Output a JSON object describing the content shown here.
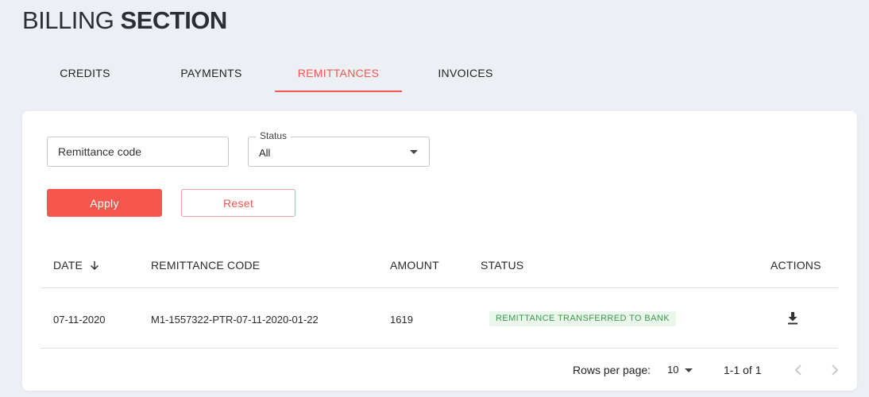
{
  "title": {
    "light": "BILLING",
    "bold": "SECTION"
  },
  "tabs": [
    {
      "label": "CREDITS",
      "active": false
    },
    {
      "label": "PAYMENTS",
      "active": false
    },
    {
      "label": "REMITTANCES",
      "active": true
    },
    {
      "label": "INVOICES",
      "active": false
    }
  ],
  "filters": {
    "remittance_code_placeholder": "Remittance code",
    "status_label": "Status",
    "status_value": "All",
    "apply_label": "Apply",
    "reset_label": "Reset"
  },
  "table": {
    "columns": [
      "DATE",
      "REMITTANCE CODE",
      "AMOUNT",
      "STATUS",
      "ACTIONS"
    ],
    "rows": [
      {
        "date": "07-11-2020",
        "code": "M1-1557322-PTR-07-11-2020-01-22",
        "amount": "1619",
        "status": "REMITTANCE TRANSFERRED TO BANK"
      }
    ]
  },
  "pagination": {
    "rows_per_page_label": "Rows per page:",
    "rows_per_page_value": "10",
    "range": "1-1 of 1"
  },
  "colors": {
    "accent": "#f5574e",
    "badge_bg": "#eaf6ec",
    "badge_text": "#3a9a4a"
  }
}
